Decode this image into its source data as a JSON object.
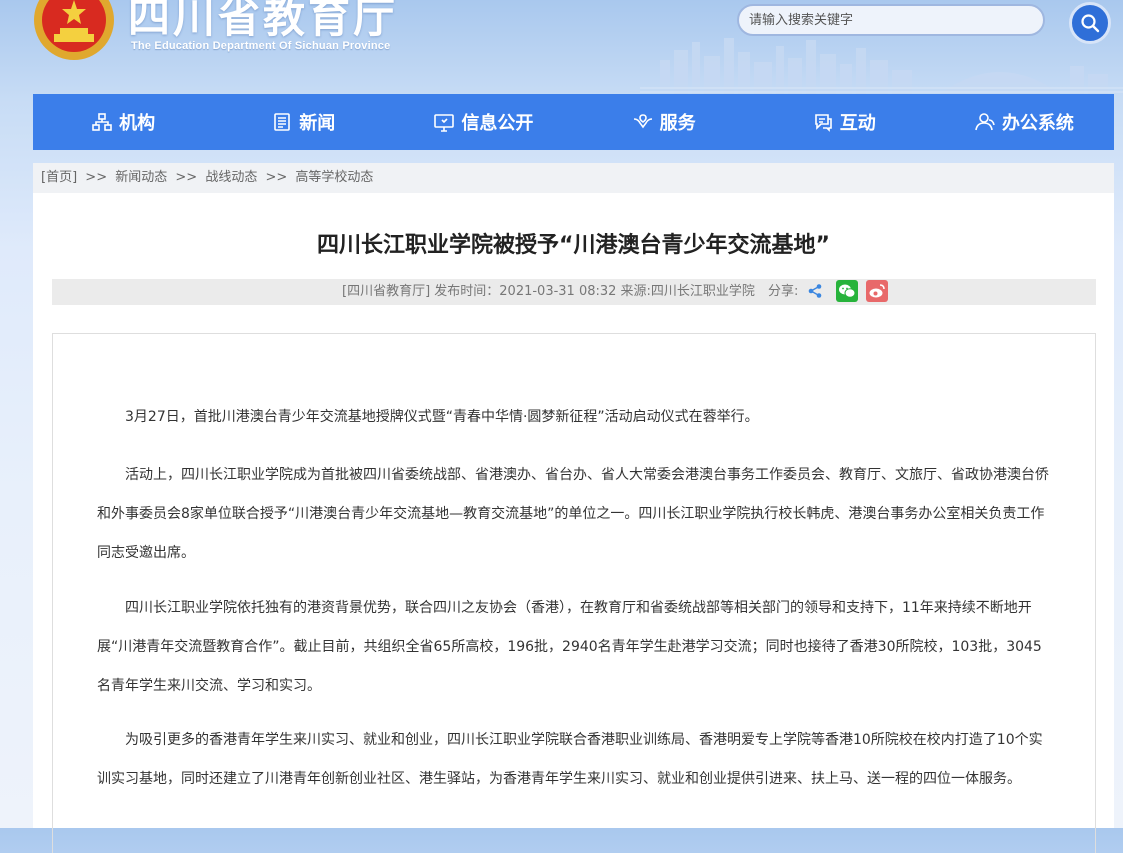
{
  "header": {
    "title": "四川省教育厅",
    "subtitle": "The Education Department Of Sichuan Province",
    "search_placeholder": "请输入搜索关键字"
  },
  "nav": {
    "items": [
      {
        "label": "机构",
        "icon": "org-chart-icon"
      },
      {
        "label": "新闻",
        "icon": "newspaper-icon"
      },
      {
        "label": "信息公开",
        "icon": "monitor-icon"
      },
      {
        "label": "服务",
        "icon": "hands-icon"
      },
      {
        "label": "互动",
        "icon": "chat-icon"
      },
      {
        "label": "办公系统",
        "icon": "user-icon"
      }
    ]
  },
  "breadcrumb": {
    "items": [
      "[首页]",
      "新闻动态",
      "战线动态",
      "高等学校动态"
    ],
    "separator": ">>"
  },
  "article": {
    "title": "四川长江职业学院被授予“川港澳台青少年交流基地”",
    "meta": "[四川省教育厅]   发布时间：2021-03-31 08:32   来源:四川长江职业学院",
    "share_label": "分享:",
    "paragraphs": [
      "3月27日，首批川港澳台青少年交流基地授牌仪式暨“青春中华情·圆梦新征程”活动启动仪式在蓉举行。",
      "活动上，四川长江职业学院成为首批被四川省委统战部、省港澳办、省台办、省人大常委会港澳台事务工作委员会、教育厅、文旅厅、省政协港澳台侨和外事委员会8家单位联合授予“川港澳台青少年交流基地—教育交流基地”的单位之一。四川长江职业学院执行校长韩虎、港澳台事务办公室相关负责工作同志受邀出席。",
      "四川长江职业学院依托独有的港资背景优势，联合四川之友协会（香港），在教育厅和省委统战部等相关部门的领导和支持下，11年来持续不断地开展“川港青年交流暨教育合作”。截止目前，共组织全省65所高校，196批，2940名青年学生赴港学习交流；同时也接待了香港30所院校，103批，3045名青年学生来川交流、学习和实习。",
      "为吸引更多的香港青年学生来川实习、就业和创业，四川长江职业学院联合香港职业训练局、香港明爱专上学院等香港10所院校在校内打造了10个实训实习基地，同时还建立了川港青年创新创业社区、港生驿站，为香港青年学生来川实习、就业和创业提供引进来、扶上马、送一程的四位一体服务。"
    ]
  },
  "colors": {
    "nav_bg": "#3b7eea",
    "wechat": "#27b33b",
    "weibo": "#e8696a",
    "share_blue": "#3a86e0"
  }
}
